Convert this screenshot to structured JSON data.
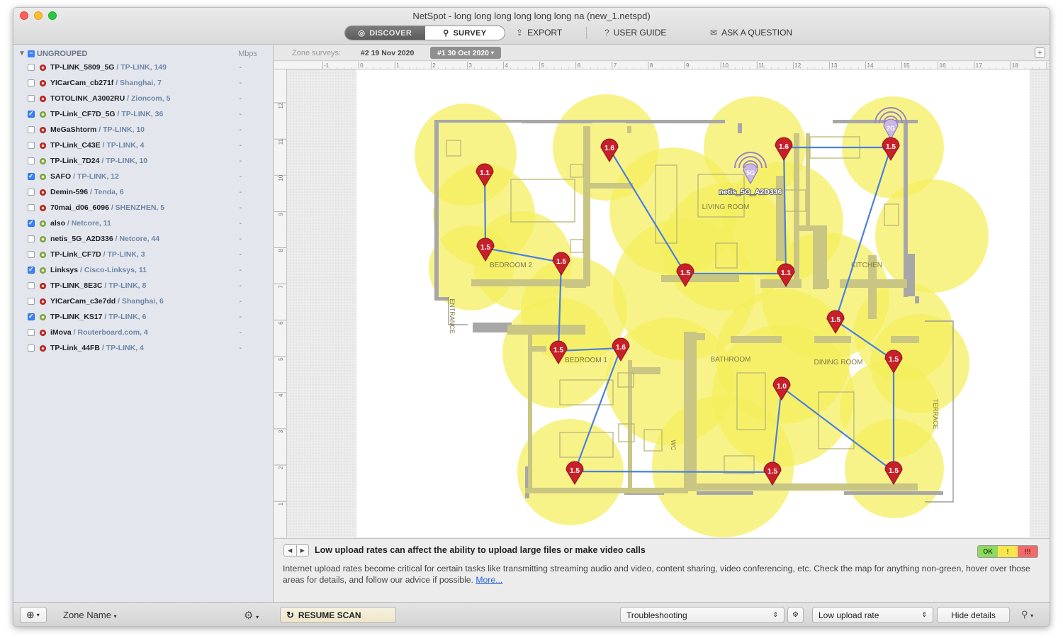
{
  "window": {
    "title": "NetSpot - long long long long long long na (new_1.netspd)"
  },
  "toolbar": {
    "discover_label": "DISCOVER",
    "survey_label": "SURVEY",
    "export_label": "EXPORT",
    "user_guide_label": "USER GUIDE",
    "ask_label": "ASK A QUESTION"
  },
  "sidebar": {
    "group_title": "UNGROUPED",
    "unit": "Mbps",
    "networks": [
      {
        "name": "TP-LINK_5809_5G",
        "vendor": " / TP-LINK, 149",
        "value": "-",
        "checked": false,
        "signal": "red"
      },
      {
        "name": "YICarCam_cb271f",
        "vendor": " / Shanghai, 7",
        "value": "-",
        "checked": false,
        "signal": "red"
      },
      {
        "name": "TOTOLINK_A3002RU",
        "vendor": " / Zioncom, 5",
        "value": "-",
        "checked": false,
        "signal": "red"
      },
      {
        "name": "TP-Link_CF7D_5G",
        "vendor": " / TP-LINK, 36",
        "value": "-",
        "checked": true,
        "signal": "green"
      },
      {
        "name": "MeGaShtorm",
        "vendor": " / TP-LINK, 10",
        "value": "-",
        "checked": false,
        "signal": "red"
      },
      {
        "name": "TP-Link_C43E",
        "vendor": " / TP-LINK, 4",
        "value": "-",
        "checked": false,
        "signal": "red"
      },
      {
        "name": "TP-Link_7D24",
        "vendor": " / TP-LINK, 10",
        "value": "-",
        "checked": false,
        "signal": "green"
      },
      {
        "name": "SAFO",
        "vendor": " / TP-LINK, 12",
        "value": "-",
        "checked": true,
        "signal": "green"
      },
      {
        "name": "Demin-596",
        "vendor": " / Tenda, 6",
        "value": "-",
        "checked": false,
        "signal": "red"
      },
      {
        "name": "70mai_d06_6096",
        "vendor": " / SHENZHEN, 5",
        "value": "-",
        "checked": false,
        "signal": "red"
      },
      {
        "name": "also",
        "vendor": " / Netcore, 11",
        "value": "-",
        "checked": true,
        "signal": "green"
      },
      {
        "name": "netis_5G_A2D336",
        "vendor": " / Netcore, 44",
        "value": "-",
        "checked": false,
        "signal": "green"
      },
      {
        "name": "TP-Link_CF7D",
        "vendor": " / TP-LINK, 3",
        "value": "-",
        "checked": false,
        "signal": "green"
      },
      {
        "name": "Linksys",
        "vendor": " / Cisco-Linksys, 11",
        "value": "-",
        "checked": true,
        "signal": "green"
      },
      {
        "name": "TP-LINK_8E3C",
        "vendor": " / TP-LINK, 8",
        "value": "-",
        "checked": false,
        "signal": "red"
      },
      {
        "name": "YICarCam_c3e7dd",
        "vendor": " / Shanghai, 6",
        "value": "-",
        "checked": false,
        "signal": "red"
      },
      {
        "name": "TP-LINK_KS17",
        "vendor": " / TP-LINK, 6",
        "value": "-",
        "checked": true,
        "signal": "green"
      },
      {
        "name": "iMova",
        "vendor": " / Routerboard.com, 4",
        "value": "-",
        "checked": false,
        "signal": "red"
      },
      {
        "name": "TP-Link_44FB",
        "vendor": " / TP-LINK, 4",
        "value": "-",
        "checked": false,
        "signal": "red"
      }
    ]
  },
  "zone_tabs": {
    "label": "Zone surveys:",
    "tabs": [
      "#2 19 Nov 2020",
      "#1 30 Oct 2020"
    ],
    "active_tab_suffix": "▾"
  },
  "rulers": {
    "top": [
      "-1",
      "0",
      "1",
      "2",
      "3",
      "4",
      "5",
      "6",
      "7",
      "8",
      "9",
      "10",
      "11",
      "12",
      "13",
      "14",
      "15",
      "16",
      "17",
      "18",
      "19"
    ],
    "left": [
      "12",
      "11",
      "10",
      "9",
      "8",
      "7",
      "6",
      "5",
      "4",
      "3",
      "2",
      "1",
      "0"
    ]
  },
  "map": {
    "rooms": [
      "LIVING ROOM",
      "BEDROOM 2",
      "KITCHEN",
      "ENTRANCE",
      "BEDROOM 1",
      "BATHROOM",
      "DINING ROOM",
      "WC",
      "TERRACE"
    ],
    "points": [
      "1.1",
      "1.5",
      "1.5",
      "1.5",
      "1.6",
      "1.1",
      "1.6",
      "1.5",
      "1.5",
      "1.5",
      "1.6",
      "1.0",
      "1.5",
      "1.5",
      "1.5",
      "1.5",
      "1.5"
    ],
    "ap_5g": {
      "band": "5G",
      "label": "netis_5G_A2D336"
    },
    "ap_2g": {
      "band": "2G",
      "label": "also"
    },
    "heat_color": "#f4ef5c",
    "marker_color": "#c8202a",
    "path_color": "#4a7fe0"
  },
  "details": {
    "title": "Low upload rates can affect the ability to upload large files or make video calls",
    "body": "Internet upload rates become critical for certain tasks like transmitting streaming audio and video, content sharing, video conferencing, etc. Check the map for anything non-green, hover over those areas for details, and follow our advice if possible. ",
    "link": "More...",
    "status": {
      "ok": "OK",
      "warn": "!",
      "bad": "!!!"
    }
  },
  "bottom": {
    "zone_name": "Zone Name",
    "zone_caret": "▾",
    "resume_label": "RESUME SCAN",
    "mode_select": "Troubleshooting",
    "metric_select": "Low upload rate",
    "hide_details": "Hide details"
  }
}
